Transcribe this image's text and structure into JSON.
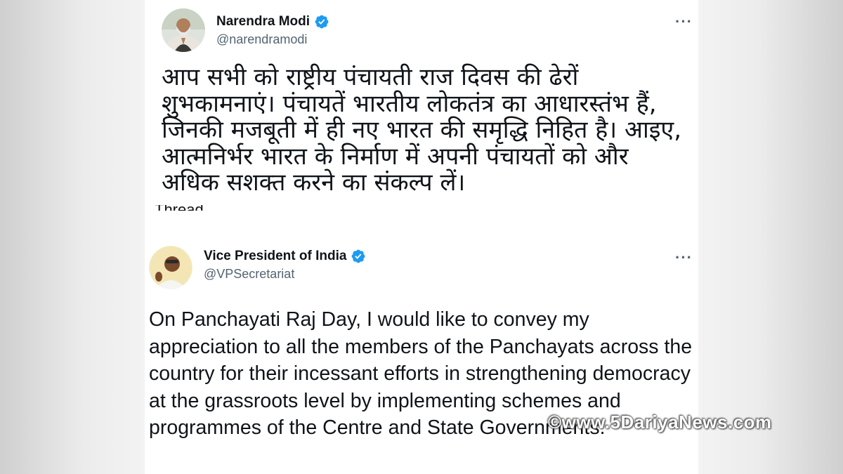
{
  "tweets": [
    {
      "display_name": "Narendra Modi",
      "handle": "@narendramodi",
      "text": "आप सभी को राष्ट्रीय पंचायती राज दिवस की ढेरों शुभकामनाएं। पंचायतें भारतीय लोकतंत्र का आधारस्तंभ हैं, जिनकी मजबूती में ही नए भारत की समृद्धि निहित है। आइए, आत्मनिर्भर भारत के निर्माण में अपनी पंचायतों को और अधिक सशक्त करने का संकल्प लें।",
      "more": "···",
      "cut_off_text": "Thread"
    },
    {
      "display_name": "Vice President of India",
      "handle": "@VPSecretariat",
      "text": "On Panchayati Raj Day, I would like to convey my appreciation to all the members of the Panchayats across the country for their incessant efforts in strengthening democracy at the grassroots level by implementing schemes and programmes of the Centre and State Governments.",
      "more": "···"
    }
  ],
  "watermark": "©www.5DariyaNews.com",
  "colors": {
    "verified": "#1d9bf0",
    "text": "#0f1419",
    "muted": "#536471"
  },
  "icons": [
    "verified-badge-icon",
    "more-options-icon"
  ]
}
